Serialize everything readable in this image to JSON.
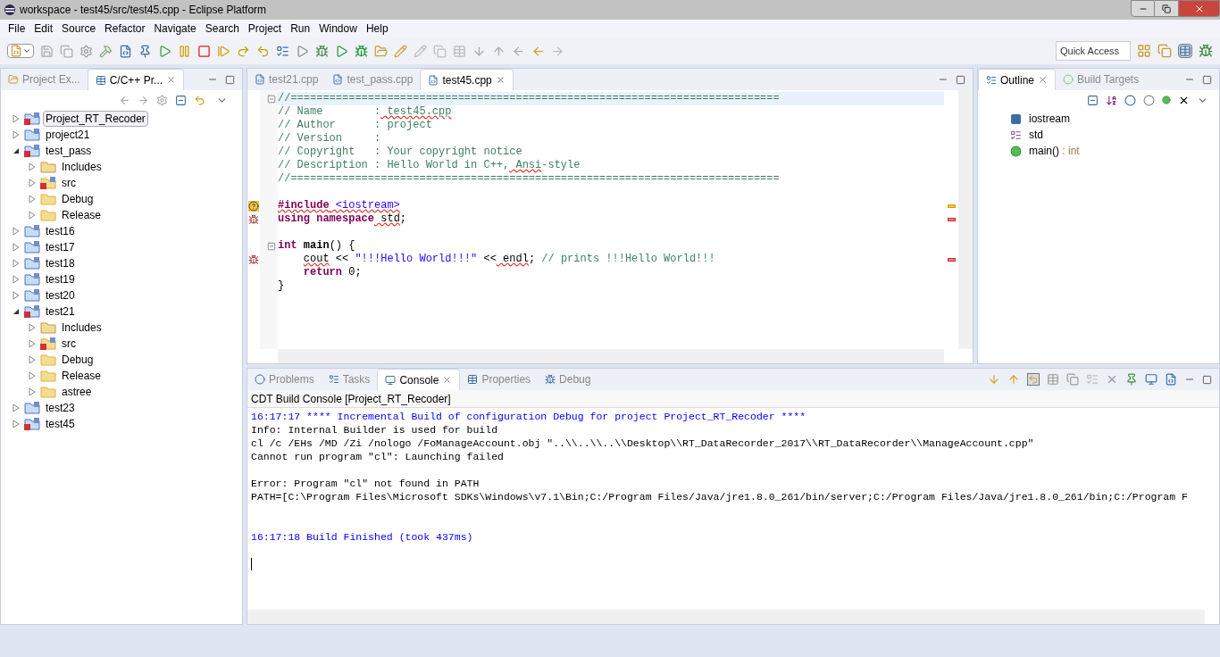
{
  "window": {
    "title": "workspace - test45/src/test45.cpp - Eclipse Platform"
  },
  "menu": [
    "File",
    "Edit",
    "Source",
    "Refactor",
    "Navigate",
    "Search",
    "Project",
    "Run",
    "Window",
    "Help"
  ],
  "quick_access": {
    "placeholder": "Quick Access"
  },
  "left_panel": {
    "tabs": [
      {
        "label": "Project Ex...",
        "selected": false
      },
      {
        "label": "C/C++ Pr...",
        "selected": true
      }
    ],
    "tree": [
      {
        "label": "Project_RT_Recoder",
        "kind": "project",
        "error": true,
        "expanded": false,
        "selected": true
      },
      {
        "label": "project21",
        "kind": "project",
        "error": false,
        "expanded": false,
        "selected": false
      },
      {
        "label": "test_pass",
        "kind": "project",
        "error": true,
        "expanded": true,
        "selected": false,
        "children": [
          {
            "label": "Includes",
            "kind": "includes",
            "error": false,
            "expanded": false,
            "selected": false
          },
          {
            "label": "src",
            "kind": "src",
            "error": true,
            "expanded": false,
            "selected": false
          },
          {
            "label": "Debug",
            "kind": "folder",
            "error": false,
            "expanded": false,
            "selected": false
          },
          {
            "label": "Release",
            "kind": "folder",
            "error": false,
            "expanded": false,
            "selected": false
          }
        ]
      },
      {
        "label": "test16",
        "kind": "project",
        "error": false,
        "expanded": false,
        "selected": false
      },
      {
        "label": "test17",
        "kind": "project",
        "error": false,
        "expanded": false,
        "selected": false
      },
      {
        "label": "test18",
        "kind": "project",
        "error": false,
        "expanded": false,
        "selected": false
      },
      {
        "label": "test19",
        "kind": "project",
        "error": false,
        "expanded": false,
        "selected": false
      },
      {
        "label": "test20",
        "kind": "project",
        "error": false,
        "expanded": false,
        "selected": false
      },
      {
        "label": "test21",
        "kind": "project",
        "error": true,
        "expanded": true,
        "selected": false,
        "children": [
          {
            "label": "Includes",
            "kind": "includes",
            "error": false,
            "expanded": false,
            "selected": false
          },
          {
            "label": "src",
            "kind": "src",
            "error": true,
            "expanded": false,
            "selected": false
          },
          {
            "label": "Debug",
            "kind": "folder",
            "error": false,
            "expanded": false,
            "selected": false
          },
          {
            "label": "Release",
            "kind": "folder",
            "error": false,
            "expanded": false,
            "selected": false
          },
          {
            "label": "astree",
            "kind": "folder",
            "error": false,
            "expanded": false,
            "selected": false
          }
        ]
      },
      {
        "label": "test23",
        "kind": "project",
        "error": false,
        "expanded": false,
        "selected": false
      },
      {
        "label": "test45",
        "kind": "project",
        "error": true,
        "expanded": false,
        "selected": false
      }
    ]
  },
  "editor": {
    "tabs": [
      {
        "label": "test21.cpp",
        "selected": false
      },
      {
        "label": "test_pass.cpp",
        "selected": false
      },
      {
        "label": "test45.cpp",
        "selected": true
      }
    ],
    "lines": [
      {
        "kind": "code",
        "fold": true,
        "current": true,
        "segments": [
          {
            "text": "//============================================================================",
            "kind": "comment",
            "squiggle": false
          }
        ]
      },
      {
        "kind": "code",
        "segments": [
          {
            "text": "// Name        :",
            "kind": "comment",
            "squiggle": false
          },
          {
            "text": " test45.cpp",
            "kind": "comment",
            "squiggle": true
          }
        ]
      },
      {
        "kind": "code",
        "segments": [
          {
            "text": "// Author      : project",
            "kind": "comment",
            "squiggle": false
          }
        ]
      },
      {
        "kind": "code",
        "segments": [
          {
            "text": "// Version     :",
            "kind": "comment",
            "squiggle": false
          }
        ]
      },
      {
        "kind": "code",
        "segments": [
          {
            "text": "// Copyright   : Your copyright notice",
            "kind": "comment",
            "squiggle": false
          }
        ]
      },
      {
        "kind": "code",
        "segments": [
          {
            "text": "// Description : Hello World in C++,",
            "kind": "comment",
            "squiggle": false
          },
          {
            "text": " Ansi",
            "kind": "comment",
            "squiggle": true
          },
          {
            "text": "-style",
            "kind": "comment",
            "squiggle": false
          }
        ]
      },
      {
        "kind": "code",
        "segments": [
          {
            "text": "//============================================================================",
            "kind": "comment",
            "squiggle": false
          }
        ]
      },
      {
        "kind": "blank"
      },
      {
        "kind": "code",
        "warning": true,
        "segments": [
          {
            "text": "#include",
            "kind": "keyword",
            "squiggle": true
          },
          {
            "text": " <iostream>",
            "kind": "include",
            "squiggle": true
          }
        ]
      },
      {
        "kind": "code",
        "error": true,
        "segments": [
          {
            "text": "using namespace",
            "kind": "keyword",
            "squiggle": false
          },
          {
            "text": " std",
            "kind": "plain",
            "squiggle": true
          },
          {
            "text": ";",
            "kind": "plain",
            "squiggle": false
          }
        ]
      },
      {
        "kind": "blank"
      },
      {
        "kind": "code",
        "fold": true,
        "segments": [
          {
            "text": "int",
            "kind": "keyword",
            "squiggle": false
          },
          {
            "text": " main",
            "kind": "function",
            "squiggle": false
          },
          {
            "text": "() {",
            "kind": "plain",
            "squiggle": false
          }
        ]
      },
      {
        "kind": "code",
        "error": true,
        "indented": true,
        "segments": [
          {
            "text": "cout",
            "kind": "plain",
            "squiggle": true
          },
          {
            "text": " <<",
            "kind": "plain",
            "squiggle": false
          },
          {
            "text": " \"!!!Hello World!!!\"",
            "kind": "string",
            "squiggle": false
          },
          {
            "text": " <<",
            "kind": "plain",
            "squiggle": false
          },
          {
            "text": " endl",
            "kind": "plain",
            "squiggle": true
          },
          {
            "text": ";",
            "kind": "plain",
            "squiggle": false
          },
          {
            "text": " // prints !!!Hello World!!!",
            "kind": "comment",
            "squiggle": false
          }
        ]
      },
      {
        "kind": "code",
        "indented": true,
        "segments": [
          {
            "text": "return",
            "kind": "keyword",
            "squiggle": false
          },
          {
            "text": " 0;",
            "kind": "plain",
            "squiggle": false
          }
        ]
      },
      {
        "kind": "code",
        "segments": [
          {
            "text": "}",
            "kind": "plain",
            "squiggle": false
          }
        ]
      }
    ]
  },
  "outline": {
    "tabs": [
      {
        "label": "Outline",
        "selected": true
      },
      {
        "label": "Build Targets",
        "selected": false
      }
    ],
    "items": [
      {
        "name": "iostream",
        "kind": "include"
      },
      {
        "name": "std",
        "kind": "namespace"
      },
      {
        "name": "main()",
        "type": " : int",
        "kind": "function"
      }
    ]
  },
  "console": {
    "tabs": [
      {
        "label": "Problems",
        "selected": false
      },
      {
        "label": "Tasks",
        "selected": false
      },
      {
        "label": "Console",
        "selected": true
      },
      {
        "label": "Properties",
        "selected": false
      },
      {
        "label": "Debug",
        "selected": false
      }
    ],
    "header": "CDT Build Console [Project_RT_Recoder]",
    "lines": [
      {
        "kind": "info",
        "text": "16:17:17 **** Incremental Build of configuration Debug for project Project_RT_Recoder ****"
      },
      {
        "kind": "plain",
        "text": "Info: Internal Builder is used for build"
      },
      {
        "kind": "plain",
        "text": "cl /c /EHs /MD /Zi /nologo /FoManageAccount.obj \"..\\\\..\\\\..\\\\Desktop\\\\RT_DataRecorder_2017\\\\RT_DataRecorder\\\\ManageAccount.cpp\""
      },
      {
        "kind": "plain",
        "text": "Cannot run program \"cl\": Launching failed"
      },
      {
        "kind": "blank"
      },
      {
        "kind": "plain",
        "text": "Error: Program \"cl\" not found in PATH"
      },
      {
        "kind": "plain",
        "text": "PATH=[C:\\Program Files\\Microsoft SDKs\\Windows\\v7.1\\Bin;C:/Program Files/Java/jre1.8.0_261/bin/server;C:/Program Files/Java/jre1.8.0_261/bin;C:/Program F"
      },
      {
        "kind": "blank"
      },
      {
        "kind": "blank"
      },
      {
        "kind": "info",
        "text": "16:17:18 Build Finished (took 437ms)"
      },
      {
        "kind": "blank"
      },
      {
        "kind": "cursor"
      }
    ]
  }
}
